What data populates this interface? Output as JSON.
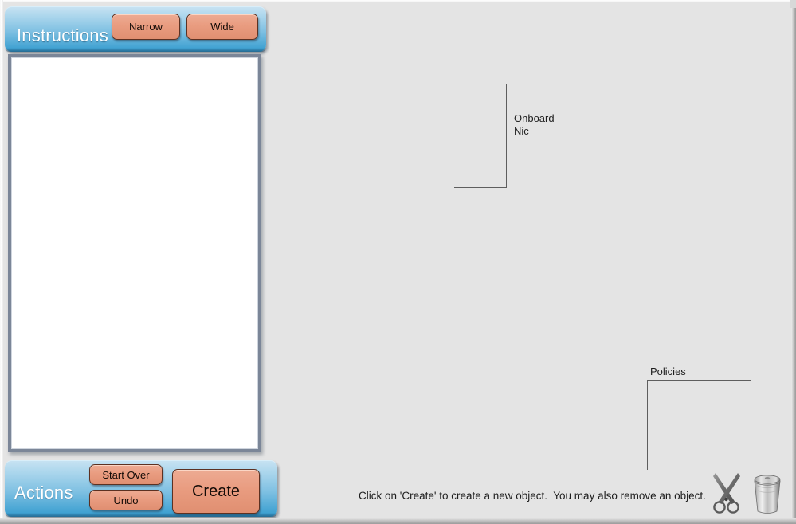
{
  "window": {
    "background_color": "#e4e4e4"
  },
  "instructions_panel": {
    "title": "Instructions",
    "buttons": {
      "narrow": "Narrow",
      "wide": "Wide"
    },
    "content": ""
  },
  "actions_panel": {
    "title": "Actions",
    "buttons": {
      "start_over": "Start Over",
      "undo": "Undo",
      "create": "Create"
    }
  },
  "canvas": {
    "brackets": [
      {
        "name": "onboard-nic",
        "label": "Onboard\nNic"
      },
      {
        "name": "policies",
        "label": "Policies"
      }
    ],
    "onboard_nic_label": "Onboard\nNic",
    "policies_label": "Policies"
  },
  "status_bar": {
    "message": "Click on 'Create' to create a new object.  You may also remove an object.",
    "tools": [
      {
        "name": "scissors-icon",
        "label": "Cut"
      },
      {
        "name": "trash-icon",
        "label": "Delete"
      }
    ]
  },
  "colors": {
    "panel_blue_light": "#c6e2f2",
    "panel_blue_dark": "#2f97cb",
    "button_orange": "#e99c80",
    "button_border": "#5c3122",
    "frame_border": "#7b8698",
    "canvas_bg": "#e4e4e4",
    "bracket_line": "#5e5e5e"
  }
}
